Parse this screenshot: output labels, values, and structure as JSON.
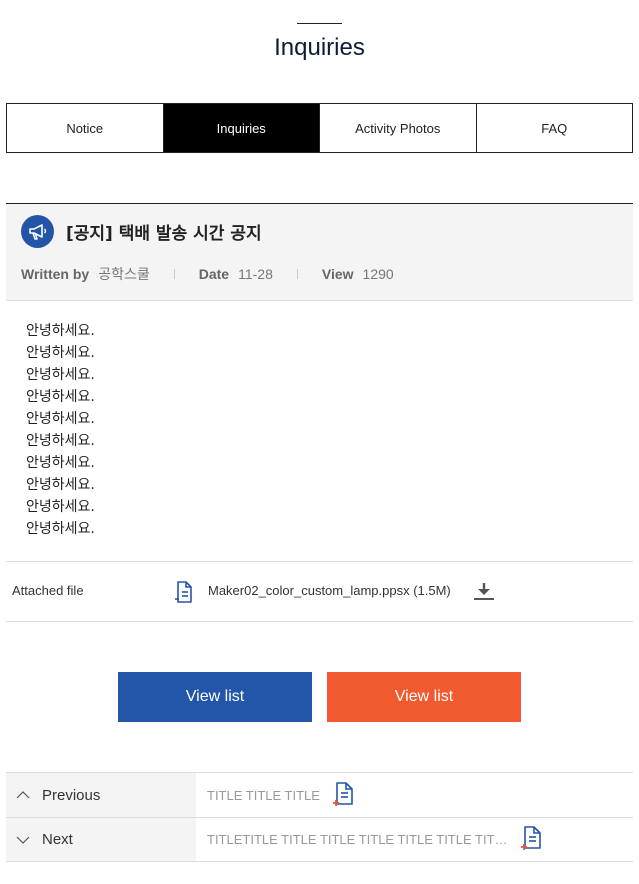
{
  "page": {
    "title": "Inquiries"
  },
  "tabs": [
    {
      "label": "Notice",
      "active": false
    },
    {
      "label": "Inquiries",
      "active": true
    },
    {
      "label": "Activity Photos",
      "active": false
    },
    {
      "label": "FAQ",
      "active": false
    }
  ],
  "post": {
    "icon": "megaphone-icon",
    "title": "[공지] 택배 발송 시간 공지",
    "meta": {
      "written_by_label": "Written by",
      "author": "공학스쿨",
      "date_label": "Date",
      "date": "11-28",
      "view_label": "View",
      "views": "1290"
    },
    "body_lines": [
      "안녕하세요.",
      "안녕하세요.",
      "안녕하세요.",
      "안녕하세요.",
      "안녕하세요.",
      "안녕하세요.",
      "안녕하세요.",
      "안녕하세요.",
      "안녕하세요.",
      "안녕하세요."
    ]
  },
  "attachment": {
    "label": "Attached file",
    "file_name": "Maker02_color_custom_lamp.ppsx (1.5M)"
  },
  "buttons": {
    "list_blue": "View list",
    "list_orange": "View list"
  },
  "navigation": {
    "previous": {
      "label": "Previous",
      "title": "TITLE TITLE TITLE"
    },
    "next": {
      "label": "Next",
      "title": "TITLETITLE TITLE TITLE TITLE TITLE TITLE TIT…"
    }
  },
  "colors": {
    "primary_blue": "#2355a9",
    "accent_orange": "#f05a2e",
    "active_tab": "#000000"
  }
}
